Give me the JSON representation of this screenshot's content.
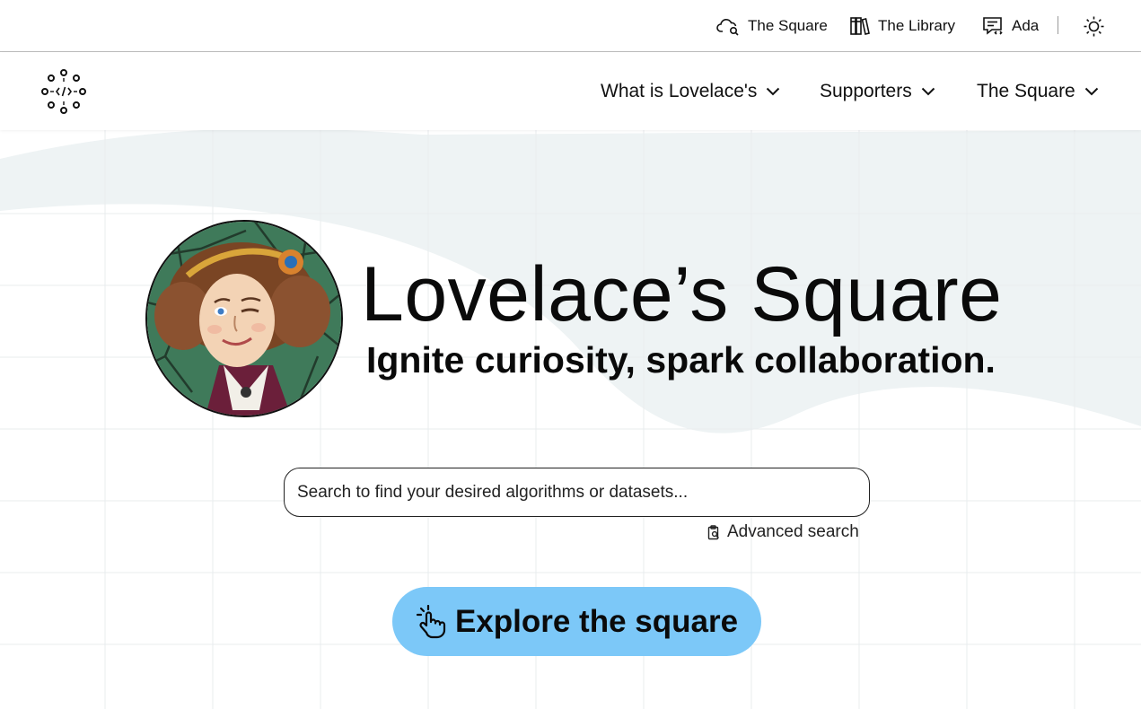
{
  "utility": {
    "square_label": "The Square",
    "library_label": "The Library",
    "ada_label": "Ada",
    "theme_icon": "sun-icon"
  },
  "nav": {
    "logo_icon": "lovelace-logo-icon",
    "items": [
      {
        "label": "What is Lovelace's"
      },
      {
        "label": "Supporters"
      },
      {
        "label": "The Square"
      }
    ]
  },
  "hero": {
    "title": "Lovelace’s Square",
    "subtitle": "Ignite curiosity, spark collaboration.",
    "search_placeholder": "Search to find your desired algorithms or datasets...",
    "advanced_search_label": "Advanced search",
    "explore_label": "Explore the square"
  },
  "colors": {
    "accent_button": "#7cc8f8",
    "blob": "#eef3f4"
  }
}
